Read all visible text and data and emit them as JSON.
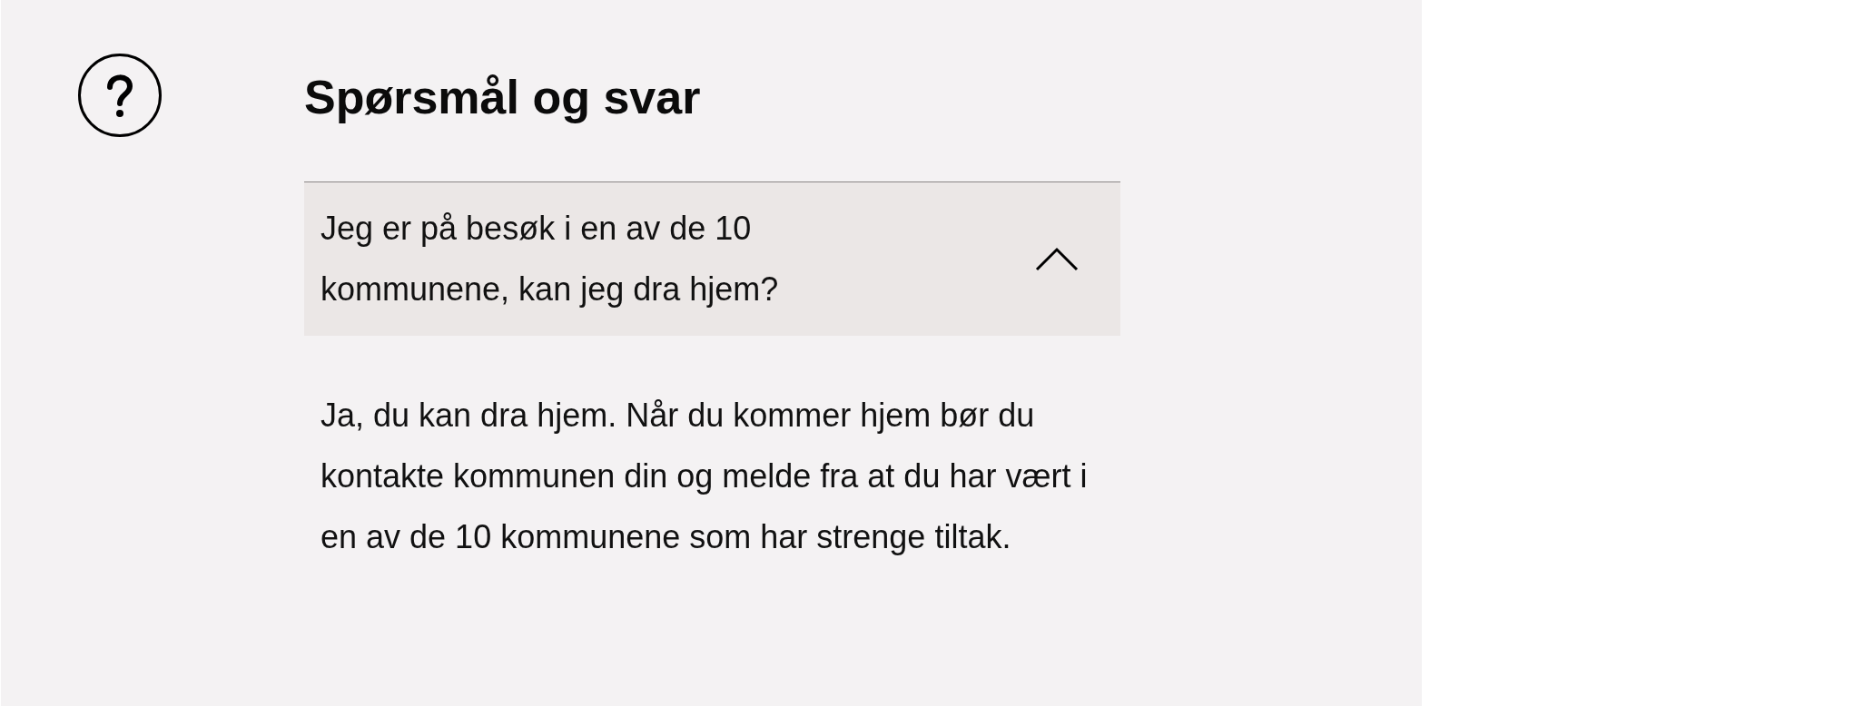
{
  "section": {
    "title": "Spørsmål og svar"
  },
  "faq": [
    {
      "question": "Jeg er på besøk i en av de 10 kommunene, kan jeg dra hjem?",
      "expanded": true,
      "answer": "Ja, du kan dra hjem. Når du kommer hjem bør du kontakte kommunen din og melde fra at du har vært i en av de 10 kommunene som har strenge tiltak."
    }
  ]
}
